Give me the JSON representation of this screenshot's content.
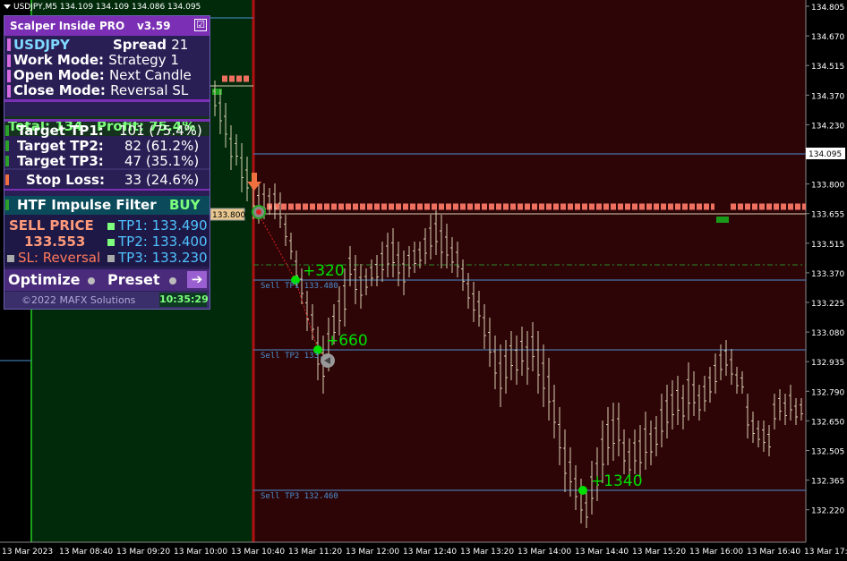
{
  "chart": {
    "header": "USDJPY,M5  134.109 134.109 134.086 134.095",
    "price_labels": [
      "134.805",
      "134.670",
      "134.515",
      "134.370",
      "134.230",
      "133.940",
      "133.800",
      "133.655",
      "133.515",
      "133.370",
      "133.225",
      "133.080",
      "132.935",
      "132.790",
      "132.650",
      "132.505",
      "132.365",
      "132.220"
    ],
    "current_price": "134.095",
    "time_labels": [
      "13 Mar 2023",
      "13 Mar 08:40",
      "13 Mar 09:20",
      "13 Mar 10:00",
      "13 Mar 10:40",
      "13 Mar 11:20",
      "13 Mar 12:00",
      "13 Mar 12:40",
      "13 Mar 13:20",
      "13 Mar 14:00",
      "13 Mar 14:40",
      "13 Mar 15:20",
      "13 Mar 16:00",
      "13 Mar 16:40",
      "13 Mar 17:2"
    ],
    "entry_label": "133.800",
    "tp_line_labels": [
      "Sell TP1 133.480",
      "Sell TP2 133.",
      "Sell TP3 132.460"
    ],
    "profit_labels": [
      "+320",
      "+660",
      "+1340"
    ],
    "colors": {
      "background": "#2e0507",
      "bull_zone": "#002a0a",
      "candles": "#d8d0b0",
      "signal_line": "#b01010",
      "tp_lines": "#4a90d0",
      "profit_text": "#00e000",
      "signal_bar": "#f07060"
    }
  },
  "panel": {
    "title": "Scalper Inside PRO",
    "version": "v3.59",
    "checkbox": "☑",
    "symbol": "USDJPY",
    "spread_label": "Spread",
    "spread_value": "21",
    "work_mode_label": "Work Mode:",
    "work_mode_value": "Strategy 1",
    "open_mode_label": "Open Mode:",
    "open_mode_value": "Next Candle",
    "close_mode_label": "Close Mode:",
    "close_mode_value": "Reversal SL",
    "total": "Total: 134",
    "profit": "Profit: 75.4%",
    "tp1_label": "Target TP1:",
    "tp1_value": "101 (75.4%)",
    "tp2_label": "Target TP2:",
    "tp2_value": "82 (61.2%)",
    "tp3_label": "Target TP3:",
    "tp3_value": "47 (35.1%)",
    "sl_label": "Stop Loss:",
    "sl_value": "33 (24.6%)",
    "htf_label": "HTF Impulse Filter",
    "htf_value": "BUY",
    "sell_price_label": "SELL PRICE",
    "sell_price_value": "133.553",
    "sl_mode": "SL: Reversal",
    "tp1": "TP1: 133.490",
    "tp2": "TP2: 133.400",
    "tp3": "TP3: 133.230",
    "optimize": "Optimize",
    "preset": "Preset",
    "arrow": "➔",
    "copyright": "©2022 MAFX Solutions",
    "clock": "10:35:29"
  }
}
